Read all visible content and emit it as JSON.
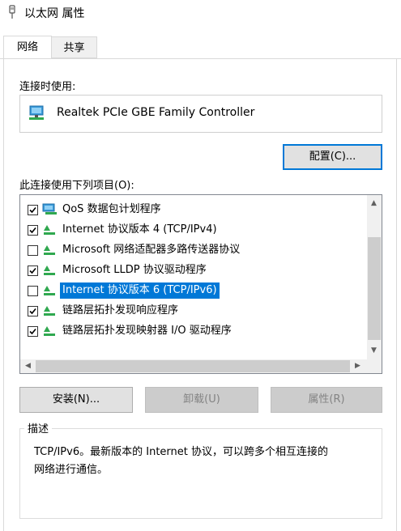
{
  "window": {
    "title": "以太网 属性"
  },
  "tabs": [
    {
      "label": "网络",
      "active": true
    },
    {
      "label": "共享",
      "active": false
    }
  ],
  "connect_using": {
    "label": "连接时使用:",
    "adapter_name": "Realtek PCIe GBE Family Controller",
    "adapter_icon": "network-adapter-icon"
  },
  "buttons": {
    "configure": "配置(C)...",
    "install": "安装(N)...",
    "uninstall": "卸载(U)",
    "properties": "属性(R)"
  },
  "items_label": "此连接使用下列项目(O):",
  "items": [
    {
      "label": "QoS 数据包计划程序",
      "checked": true,
      "icon": "qos-scheduler-icon",
      "selected": false
    },
    {
      "label": "Internet 协议版本 4 (TCP/IPv4)",
      "checked": true,
      "icon": "protocol-icon",
      "selected": false
    },
    {
      "label": "Microsoft 网络适配器多路传送器协议",
      "checked": false,
      "icon": "protocol-icon",
      "selected": false
    },
    {
      "label": "Microsoft LLDP 协议驱动程序",
      "checked": true,
      "icon": "protocol-icon",
      "selected": false
    },
    {
      "label": "Internet 协议版本 6 (TCP/IPv6)",
      "checked": false,
      "icon": "protocol-icon",
      "selected": true
    },
    {
      "label": "链路层拓扑发现响应程序",
      "checked": true,
      "icon": "protocol-icon",
      "selected": false
    },
    {
      "label": "链路层拓扑发现映射器 I/O 驱动程序",
      "checked": true,
      "icon": "protocol-icon",
      "selected": false
    }
  ],
  "description": {
    "title": "描述",
    "text_line1": "TCP/IPv6。最新版本的 Internet 协议，可以跨多个相互连接的",
    "text_line2": "网络进行通信。"
  },
  "colors": {
    "selection": "#0078d7",
    "focus_border": "#0078d7"
  }
}
